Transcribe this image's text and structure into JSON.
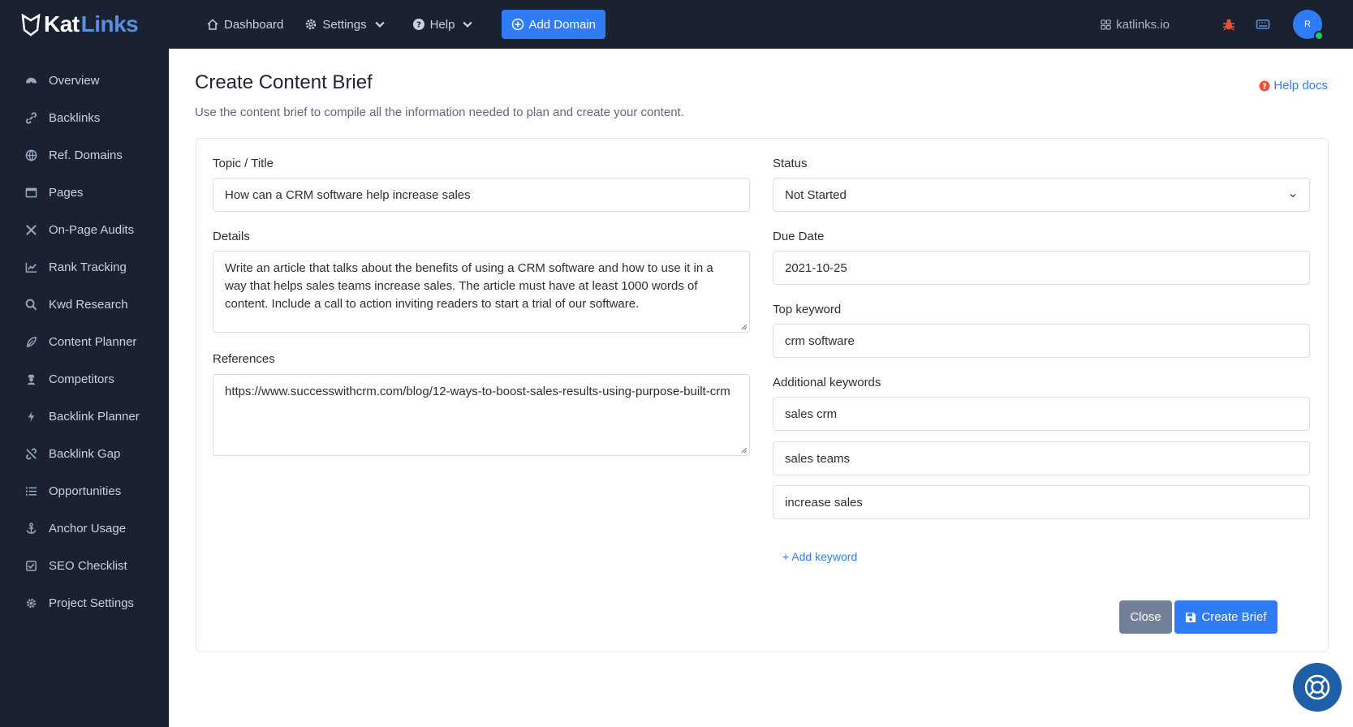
{
  "brand": {
    "logo_a": "Kat",
    "logo_b": "Links"
  },
  "sidebar": {
    "items": [
      {
        "label": "Overview",
        "icon": "dashboard-gauge-icon"
      },
      {
        "label": "Backlinks",
        "icon": "link-icon"
      },
      {
        "label": "Ref. Domains",
        "icon": "globe-icon"
      },
      {
        "label": "Pages",
        "icon": "window-icon"
      },
      {
        "label": "On-Page Audits",
        "icon": "tools-icon"
      },
      {
        "label": "Rank Tracking",
        "icon": "chart-line-icon"
      },
      {
        "label": "Kwd Research",
        "icon": "search-icon"
      },
      {
        "label": "Content Planner",
        "icon": "feather-icon"
      },
      {
        "label": "Competitors",
        "icon": "user-secret-icon"
      },
      {
        "label": "Backlink Planner",
        "icon": "bolt-icon"
      },
      {
        "label": "Backlink Gap",
        "icon": "unlink-icon"
      },
      {
        "label": "Opportunities",
        "icon": "list-icon"
      },
      {
        "label": "Anchor Usage",
        "icon": "anchor-icon"
      },
      {
        "label": "SEO Checklist",
        "icon": "checkbox-icon"
      },
      {
        "label": "Project Settings",
        "icon": "gear-icon"
      }
    ]
  },
  "topbar": {
    "dashboard": "Dashboard",
    "settings": "Settings",
    "help": "Help",
    "add_domain": "Add Domain",
    "site": "katlinks.io",
    "avatar_initial": "R"
  },
  "page": {
    "title": "Create Content Brief",
    "subtitle": "Use the content brief to compile all the information needed to plan and create your content.",
    "help_docs": "Help docs"
  },
  "form": {
    "topic_label": "Topic / Title",
    "topic_value": "How can a CRM software help increase sales",
    "details_label": "Details",
    "details_value": "Write an article that talks about the benefits of using a CRM software and how to use it in a way that helps sales teams increase sales. The article must have at least 1000 words of content. Include a call to action inviting readers to start a trial of our software.",
    "references_label": "References",
    "references_value": "https://www.successwithcrm.com/blog/12-ways-to-boost-sales-results-using-purpose-built-crm",
    "status_label": "Status",
    "status_value": "Not Started",
    "due_label": "Due Date",
    "due_value": "2021-10-25",
    "top_keyword_label": "Top keyword",
    "top_keyword_value": "crm software",
    "additional_label": "Additional keywords",
    "additional": [
      "sales crm",
      "sales teams",
      "increase sales"
    ],
    "add_keyword": "+ Add keyword",
    "close": "Close",
    "create": "Create Brief"
  },
  "colors": {
    "sidebar_bg": "#1a2231",
    "accent": "#2f7cf6",
    "close_btn": "#72809a"
  }
}
